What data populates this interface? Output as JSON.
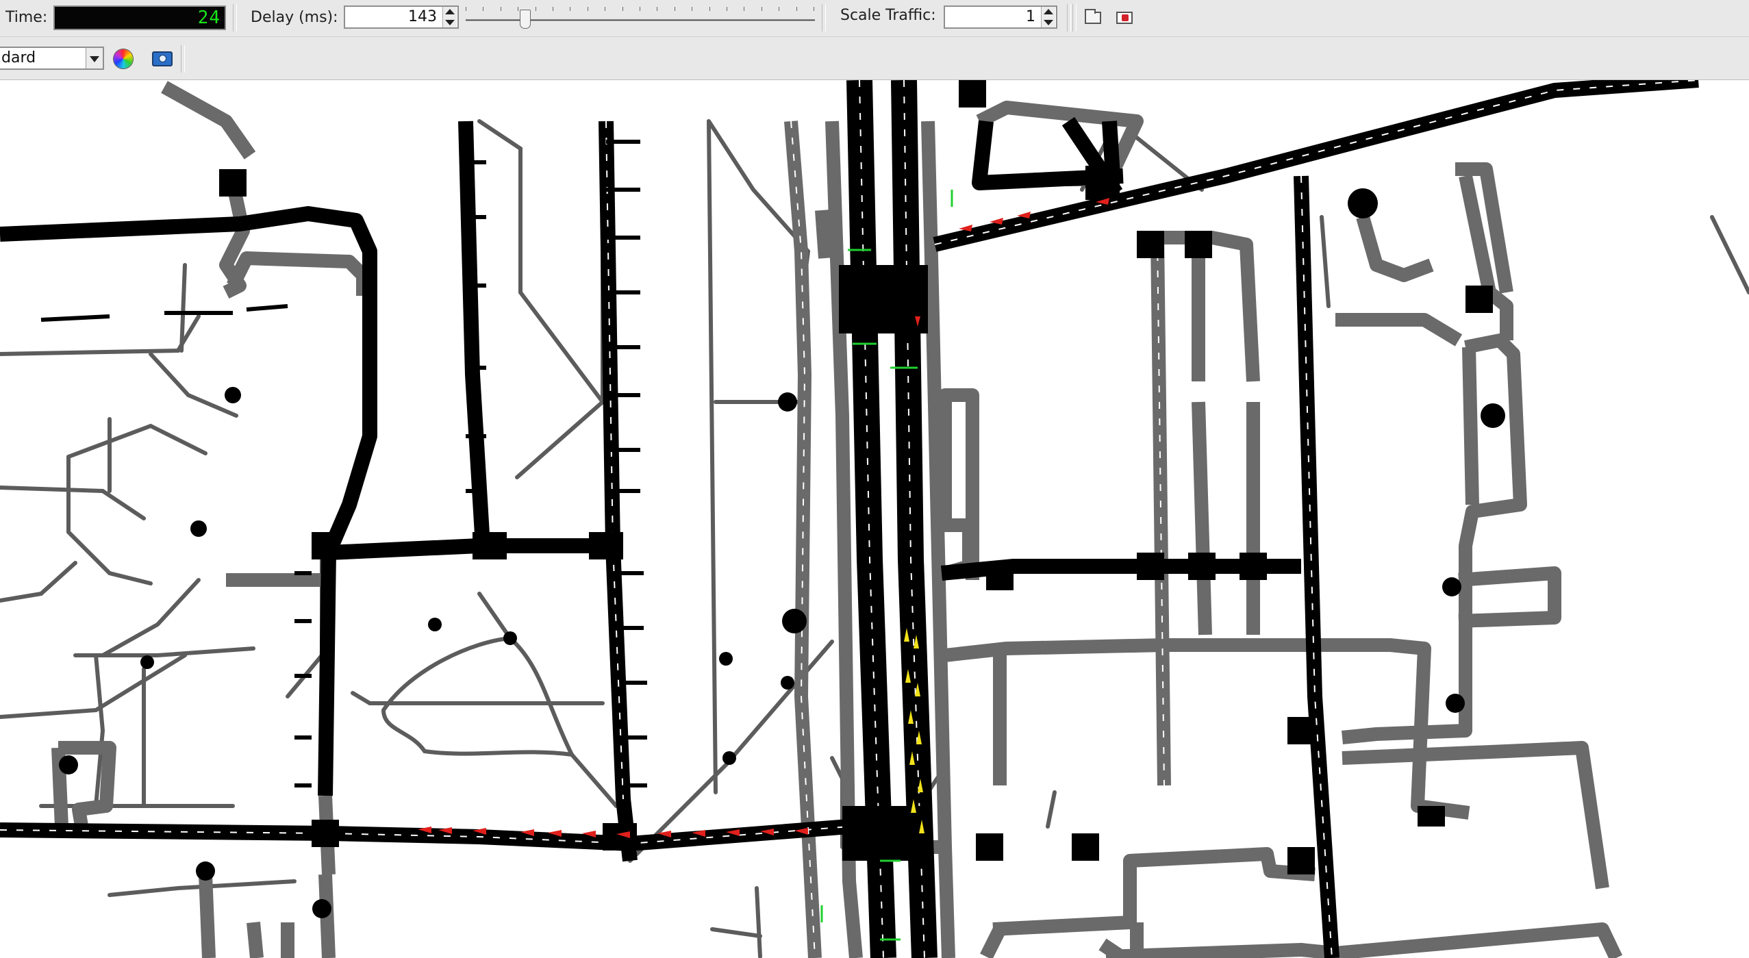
{
  "toolbar": {
    "time_label": "Time:",
    "time_value": "24",
    "delay_label": "Delay (ms):",
    "delay_value": "143",
    "delay_slider_fraction": 0.16,
    "scale_label": "Scale Traffic:",
    "scale_value": "1",
    "buttons": [
      "open-view-icon",
      "close-view-icon"
    ]
  },
  "view": {
    "scheme_value": "dard",
    "icons": [
      "color-wheel-icon",
      "camera-icon"
    ]
  },
  "colors": {
    "major_road": "#000000",
    "minor_road": "#6a6a6a",
    "path": "#5c5c5c",
    "vehicle_red": "#e0201c",
    "vehicle_yellow": "#f2e21a",
    "stop_line_green": "#20d030",
    "background": "#ffffff"
  }
}
